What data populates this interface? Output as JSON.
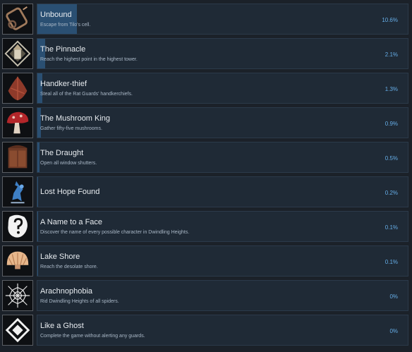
{
  "achievements": [
    {
      "title": "Unbound",
      "description": "Escape from Tilo's cell.",
      "percent": "10.6%",
      "rarity": 0.106,
      "icon": "broken-shackle-icon"
    },
    {
      "title": "The Pinnacle",
      "description": "Reach the highest point in the highest tower.",
      "percent": "2.1%",
      "rarity": 0.021,
      "icon": "tower-compass-icon"
    },
    {
      "title": "Handker-thief",
      "description": "Steal all of the Rat Guards' handkerchiefs.",
      "percent": "1.3%",
      "rarity": 0.013,
      "icon": "handkerchief-icon"
    },
    {
      "title": "The Mushroom King",
      "description": "Gather fifty-five mushrooms.",
      "percent": "0.9%",
      "rarity": 0.009,
      "icon": "mushroom-icon"
    },
    {
      "title": "The Draught",
      "description": "Open all window shutters.",
      "percent": "0.5%",
      "rarity": 0.005,
      "icon": "window-shutters-icon"
    },
    {
      "title": "Lost Hope Found",
      "description": "",
      "percent": "0.2%",
      "rarity": 0.002,
      "icon": "ghost-figure-icon"
    },
    {
      "title": "A Name to a Face",
      "description": "Discover the name of every possible character in Dwindling Heights.",
      "percent": "0.1%",
      "rarity": 0.001,
      "icon": "question-mark-face-icon"
    },
    {
      "title": "Lake Shore",
      "description": "Reach the desolate shore.",
      "percent": "0.1%",
      "rarity": 0.001,
      "icon": "seashell-icon"
    },
    {
      "title": "Arachnophobia",
      "description": "Rid Dwindling Heights of all spiders.",
      "percent": "0%",
      "rarity": 0,
      "icon": "spider-web-icon"
    },
    {
      "title": "Like a Ghost",
      "description": "Complete the game without alerting any guards.",
      "percent": "0%",
      "rarity": 0,
      "icon": "diamond-eye-icon"
    }
  ],
  "colors": {
    "progress": "#2a4f72",
    "percent_text": "#66aee8",
    "panel": "#1f2a36"
  }
}
